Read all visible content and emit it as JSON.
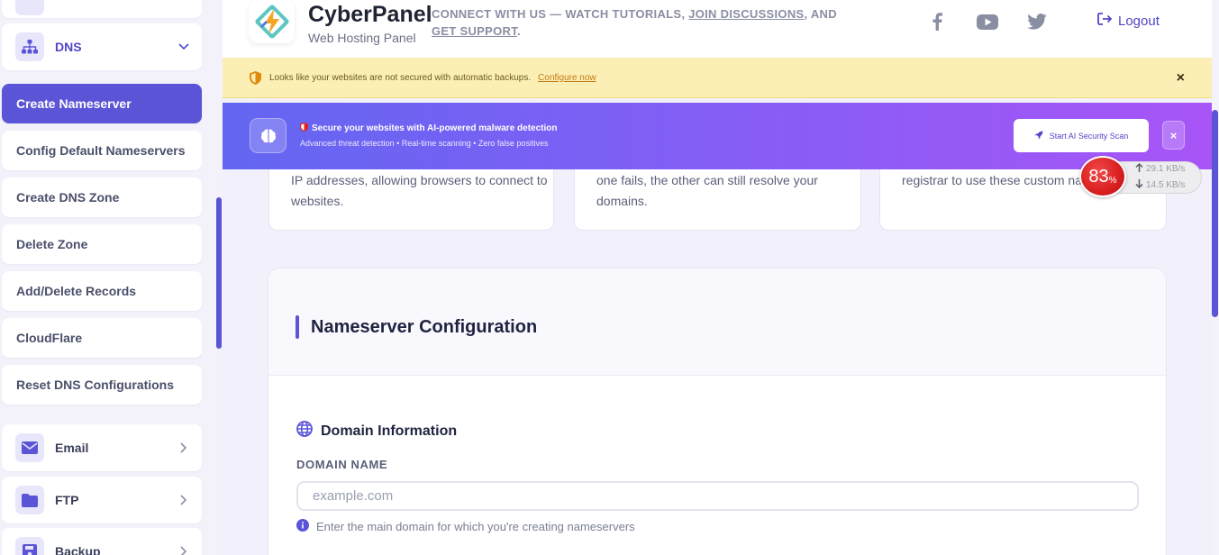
{
  "sidebar": {
    "dns_label": "DNS",
    "sub_items": [
      {
        "label": "Create Nameserver",
        "active": true
      },
      {
        "label": "Config Default Nameservers"
      },
      {
        "label": "Create DNS Zone"
      },
      {
        "label": "Delete Zone"
      },
      {
        "label": "Add/Delete Records"
      },
      {
        "label": "CloudFlare"
      },
      {
        "label": "Reset DNS Configurations"
      }
    ],
    "menu": [
      {
        "label": "Email",
        "icon": "envelope-icon"
      },
      {
        "label": "FTP",
        "icon": "folder-icon"
      },
      {
        "label": "Backup",
        "icon": "save-icon"
      }
    ],
    "accent": "#5b54d6"
  },
  "header": {
    "brand": "CyberPanel",
    "subtitle": "Web Hosting Panel",
    "connect_prefix": "CONNECT WITH US — WATCH TUTORIALS, ",
    "join_link": "JOIN DISCUSSIONS",
    "connect_mid": ", AND ",
    "support_link": "GET SUPPORT",
    "connect_suffix": ".",
    "social": [
      "facebook-icon",
      "youtube-icon",
      "twitter-icon"
    ],
    "logout": "Logout"
  },
  "backup_banner": {
    "message": "Looks like your websites are not secured with automatic backups.",
    "link": "Configure now",
    "close": "×"
  },
  "ai_banner": {
    "title": "Secure your websites with AI-powered malware detection",
    "subtitle": "Advanced threat detection • Real-time scanning • Zero false positives",
    "button": "Start AI Security Scan",
    "close": "×"
  },
  "info_cards": [
    {
      "text": "IP addresses, allowing browsers to connect to websites."
    },
    {
      "text": "one fails, the other can still resolve your domains."
    },
    {
      "text": "registrar to use these custom na"
    }
  ],
  "speed_widget": {
    "percent": "83",
    "percent_sign": "%",
    "upload": "29.1 KB/s",
    "download": "14.5 KB/s"
  },
  "main": {
    "title": "Nameserver Configuration",
    "section_title": "Domain Information",
    "field_label": "DOMAIN NAME",
    "placeholder": "example.com",
    "help": "Enter the main domain for which you're creating nameservers"
  }
}
